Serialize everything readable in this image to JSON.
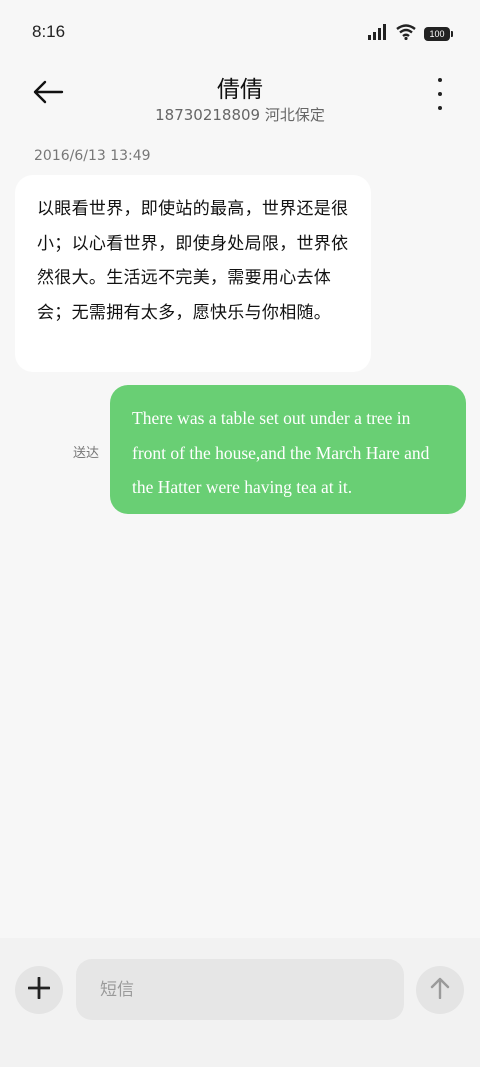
{
  "status_bar": {
    "time": "8:16",
    "battery": "100",
    "signal_icon": "cell-signal-icon",
    "wifi_icon": "wifi-icon"
  },
  "header": {
    "back_icon": "arrow-left-icon",
    "contact_name": "倩倩",
    "contact_info": "18730218809 河北保定",
    "menu_icon": "more-vertical-icon"
  },
  "conversation": {
    "timestamp": "2016/6/13 13:49",
    "incoming_message": "以眼看世界，即使站的最高，世界还是很小；以心看世界，即使身处局限，世界依然很大。生活远不完美，需要用心去体会；无需拥有太多，愿快乐与你相随。",
    "outgoing_message": "There was a table set out under a tree in front of the house,and the March Hare and the Hatter were having tea at it.",
    "outgoing_status": "送达",
    "outgoing_bubble_color": "#69cf74"
  },
  "composer": {
    "placeholder": "短信",
    "add_icon": "plus-icon",
    "send_icon": "arrow-up-icon"
  }
}
